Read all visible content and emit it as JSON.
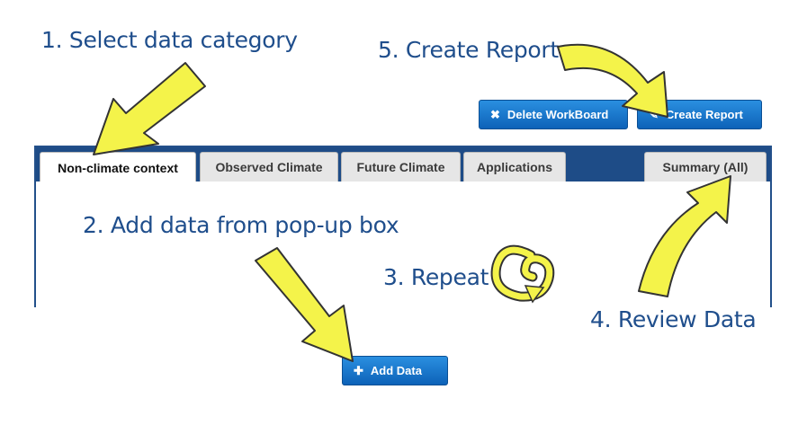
{
  "steps": {
    "step1": "1. Select data category",
    "step2": "2. Add data from pop-up box",
    "step3": "3. Repeat",
    "step4": "4. Review Data",
    "step5": "5. Create Report"
  },
  "toolbar": {
    "delete_label": "Delete WorkBoard",
    "delete_icon": "close-icon",
    "create_label": "Create Report",
    "create_icon": "pencil-icon"
  },
  "tabs": [
    {
      "label": "Non-climate context",
      "active": true
    },
    {
      "label": "Observed Climate",
      "active": false
    },
    {
      "label": "Future Climate",
      "active": false
    },
    {
      "label": "Applications",
      "active": false
    },
    {
      "label": "Summary (All)",
      "active": false
    }
  ],
  "add_data": {
    "label": "Add Data",
    "icon": "plus-icon"
  },
  "colors": {
    "step_text": "#1f4e8c",
    "button_blue": "#0d62b8",
    "tabbar_blue": "#1e4c87",
    "arrow_yellow": "#f4f34a"
  }
}
